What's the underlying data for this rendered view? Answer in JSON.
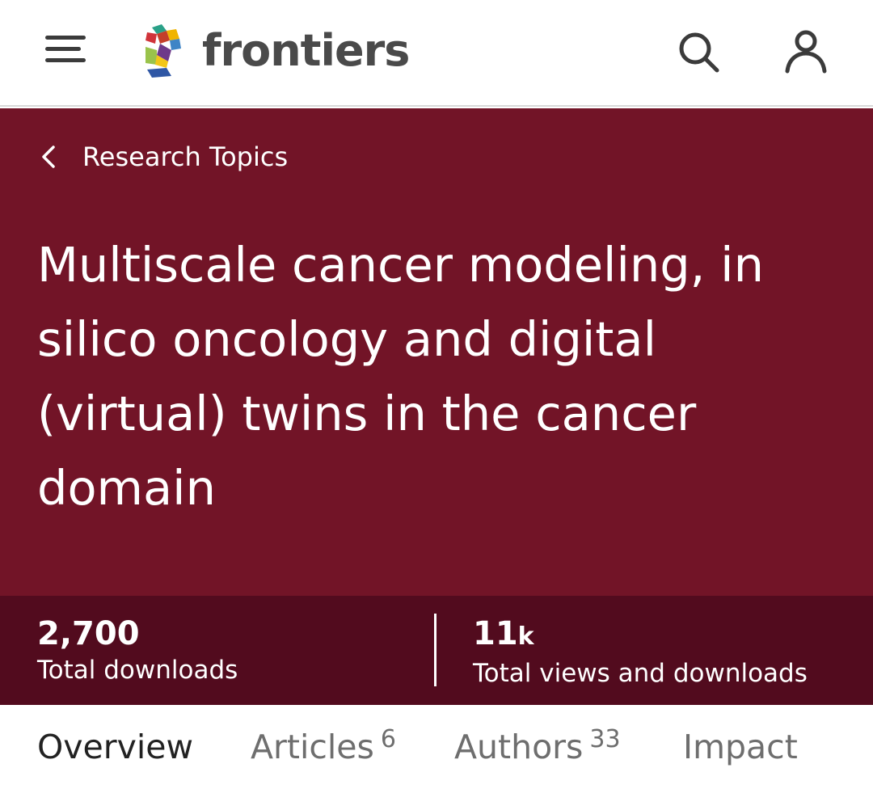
{
  "header": {
    "brand": "frontiers",
    "icons": {
      "menu": "hamburger-menu-icon",
      "search": "search-icon",
      "account": "user-icon"
    },
    "brand_colors": [
      "#d0343a",
      "#3e84c6",
      "#f0b400",
      "#2aa188",
      "#9ac34b",
      "#2f57a5"
    ]
  },
  "hero": {
    "background": "#721427",
    "breadcrumb": "Research Topics",
    "title": "Multiscale cancer modeling, in silico oncology and digital (virtual) twins in the cancer domain"
  },
  "stats": {
    "background": "#520b1e",
    "downloads": {
      "value": "2,700",
      "label": "Total downloads"
    },
    "views": {
      "value": "11",
      "suffix": "k",
      "label": "Total views and downloads"
    }
  },
  "tabs": [
    {
      "label": "Overview",
      "count": ""
    },
    {
      "label": "Articles",
      "count": "6"
    },
    {
      "label": "Authors",
      "count": "33"
    },
    {
      "label": "Impact",
      "count": ""
    }
  ]
}
